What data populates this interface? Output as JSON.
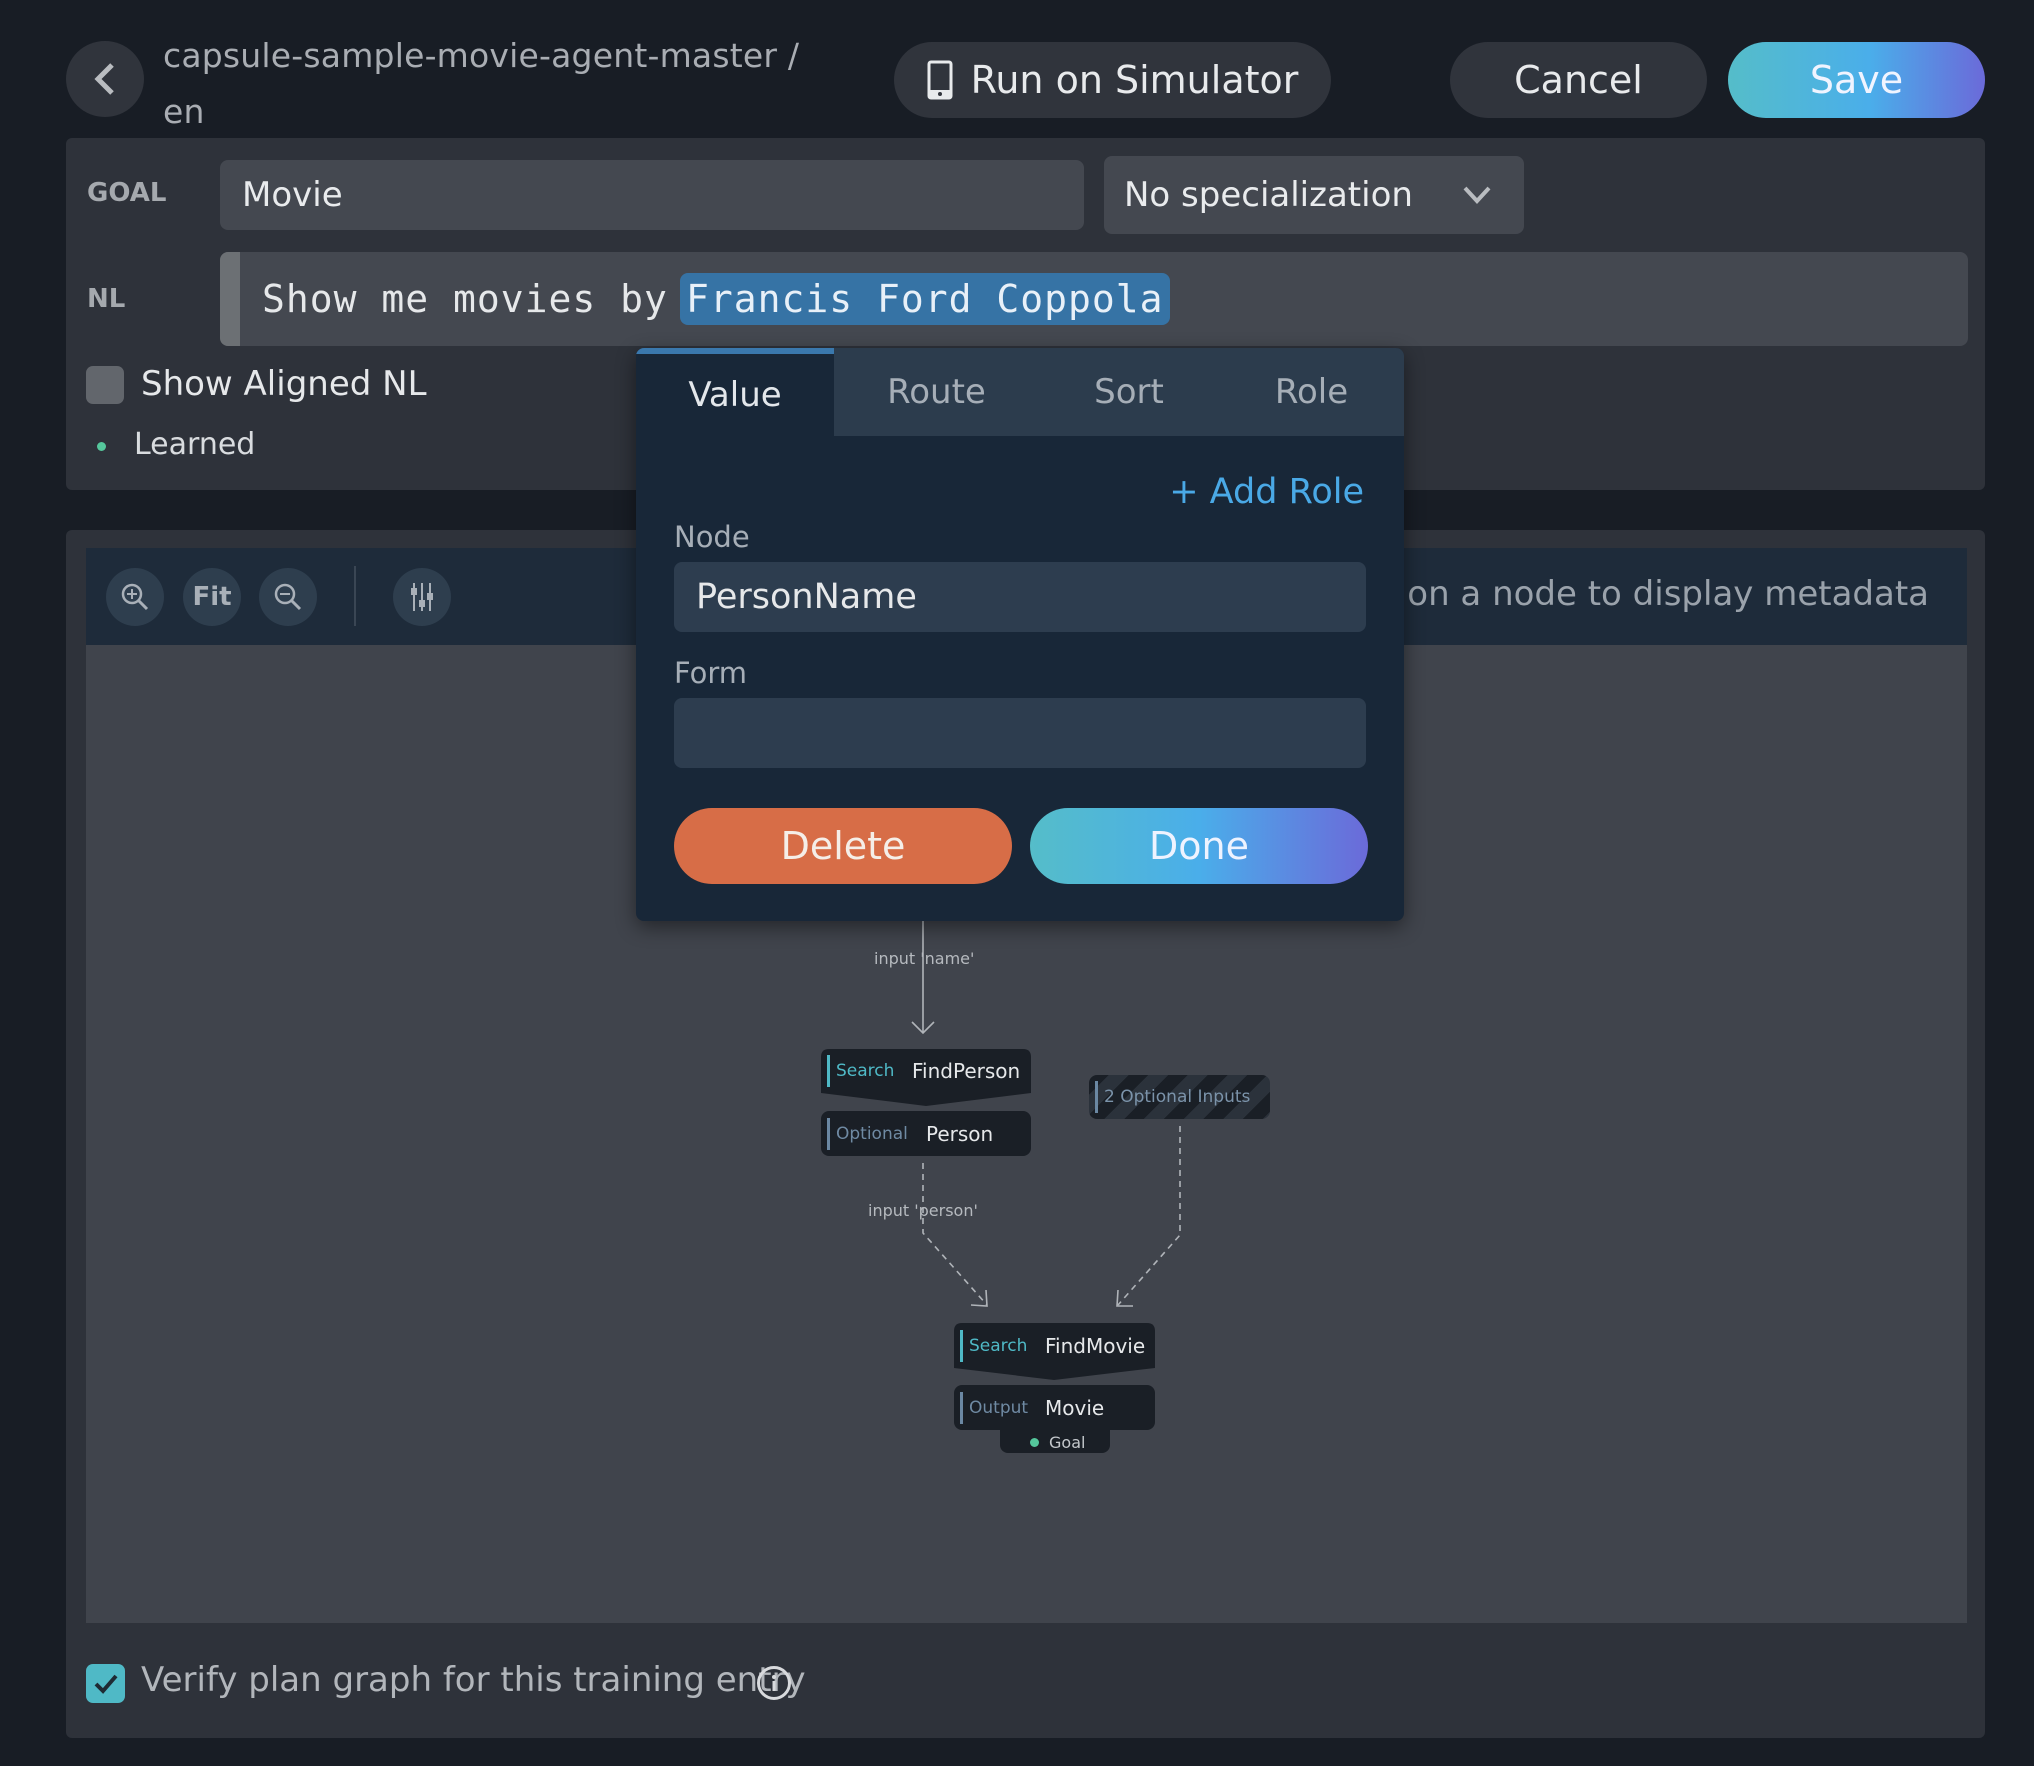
{
  "header": {
    "back_icon": "chevron-left-icon",
    "title_line1": "capsule-sample-movie-agent-master /",
    "title_line2": "en",
    "run_simulator_label": "Run on Simulator",
    "run_simulator_icon": "mobile-device-icon",
    "cancel_label": "Cancel",
    "save_label": "Save"
  },
  "goal": {
    "label": "GOAL",
    "value": "Movie",
    "specialization": {
      "selected": "No specialization",
      "icon": "chevron-down-icon"
    }
  },
  "nl": {
    "label": "NL",
    "text_before": "Show me movies by",
    "highlighted": "Francis Ford Coppola"
  },
  "options": {
    "show_aligned_nl_label": "Show Aligned NL",
    "show_aligned_nl_checked": false,
    "status_label": "Learned",
    "status_color": "#55c79c"
  },
  "graph_toolbar": {
    "zoom_in_icon": "zoom-in-icon",
    "fit_label": "Fit",
    "zoom_out_icon": "zoom-out-icon",
    "settings_icon": "sliders-icon",
    "hint": "Hover on a node to display metadata"
  },
  "plan_graph": {
    "edges": [
      {
        "label": "input 'name'",
        "style": "solid"
      },
      {
        "label": "input 'person'",
        "style": "dashed"
      },
      {
        "label": "",
        "style": "dashed"
      }
    ],
    "nodes": {
      "find_person": {
        "kind": "Search",
        "name": "FindPerson"
      },
      "person": {
        "kind": "Optional",
        "name": "Person"
      },
      "optional_inputs": {
        "label": "2 Optional Inputs"
      },
      "find_movie": {
        "kind": "Search",
        "name": "FindMovie"
      },
      "movie": {
        "kind": "Output",
        "name": "Movie",
        "badge": "Goal"
      }
    }
  },
  "verify": {
    "label": "Verify plan graph for this training entry",
    "checked": true,
    "info_icon": "info-icon"
  },
  "popup": {
    "tabs": [
      {
        "label": "Value",
        "active": true
      },
      {
        "label": "Route",
        "active": false
      },
      {
        "label": "Sort",
        "active": false
      },
      {
        "label": "Role",
        "active": false
      }
    ],
    "add_role_label": "+ Add Role",
    "node_label": "Node",
    "node_value": "PersonName",
    "form_label": "Form",
    "form_value": "",
    "delete_label": "Delete",
    "done_label": "Done"
  },
  "colors": {
    "accent_blue": "#4aa9e6",
    "highlight": "#3673a5",
    "delete": "#d76d47",
    "search_kind": "#4fb9c6",
    "goal_dot": "#55c79c"
  }
}
